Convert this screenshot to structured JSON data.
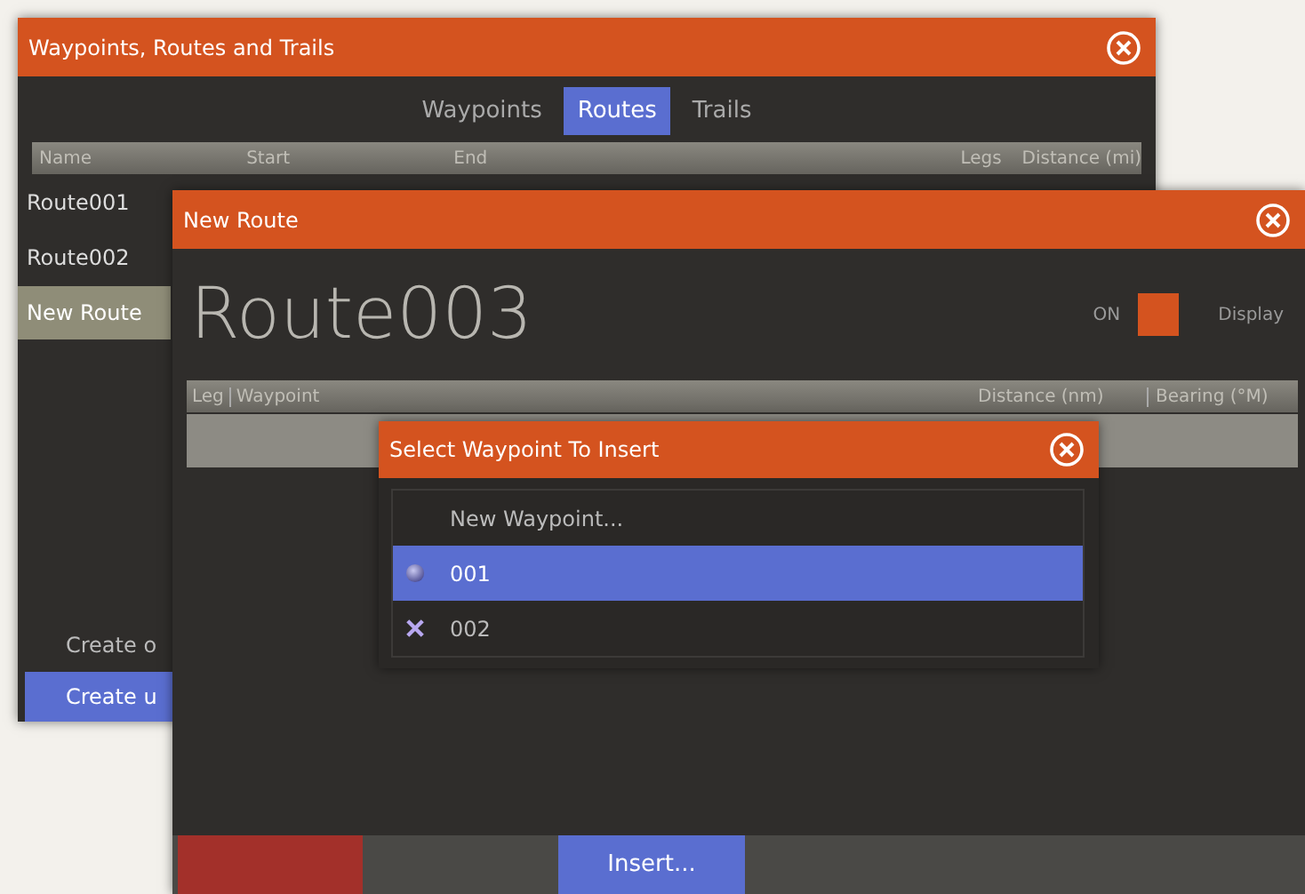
{
  "routes_window": {
    "title": "Waypoints, Routes and Trails",
    "tabs": [
      {
        "label": "Waypoints",
        "selected": false
      },
      {
        "label": "Routes",
        "selected": true
      },
      {
        "label": "Trails",
        "selected": false
      }
    ],
    "columns": [
      "Name",
      "Start",
      "End",
      "Legs",
      "Distance (mi)"
    ],
    "rows": [
      {
        "name": "Route001",
        "selected": false
      },
      {
        "name": "Route002",
        "selected": false
      },
      {
        "name": "New Route",
        "selected": true
      }
    ],
    "footer_text": "Create o",
    "footer_button": "Create u"
  },
  "new_route_window": {
    "title": "New Route",
    "route_name": "Route003",
    "display": {
      "on": true,
      "state_label": "ON",
      "label": "Display"
    },
    "columns": [
      "Leg",
      "Waypoint",
      "Distance (nm)",
      "Bearing (°M)"
    ],
    "buttons": [
      {
        "label": "Insert..."
      }
    ]
  },
  "select_dialog": {
    "title": "Select Waypoint To Insert",
    "items": [
      {
        "kind": "new",
        "label": "New Waypoint...",
        "selected": false
      },
      {
        "kind": "circle",
        "label": "001",
        "selected": true
      },
      {
        "kind": "cross",
        "label": "002",
        "selected": false
      }
    ]
  }
}
